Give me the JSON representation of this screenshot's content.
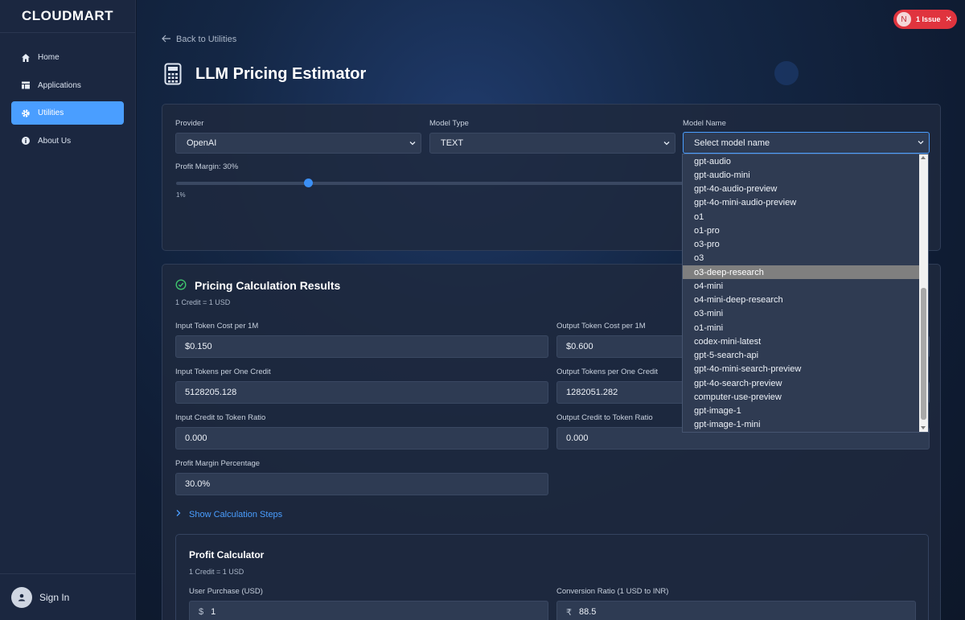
{
  "brand": "CLOUDMART",
  "nav": {
    "items": [
      {
        "label": "Home",
        "icon": "home-icon"
      },
      {
        "label": "Applications",
        "icon": "applications-icon"
      },
      {
        "label": "Utilities",
        "icon": "gear-icon",
        "active": true
      },
      {
        "label": "About Us",
        "icon": "info-icon"
      }
    ]
  },
  "sidebar_footer": {
    "sign_in": "Sign In"
  },
  "issue_badge": {
    "letter": "N",
    "label": "1 Issue"
  },
  "header": {
    "back_label": "Back to Utilities",
    "title": "LLM Pricing Estimator"
  },
  "config": {
    "provider_label": "Provider",
    "provider_value": "OpenAI",
    "model_type_label": "Model Type",
    "model_type_value": "TEXT",
    "model_name_label": "Model Name",
    "model_name_value": "Select model name",
    "profit_margin_label": "Profit Margin: 30%",
    "profit_margin_value": 30,
    "slider_min": "1%"
  },
  "model_options": [
    "gpt-audio",
    "gpt-audio-mini",
    "gpt-4o-audio-preview",
    "gpt-4o-mini-audio-preview",
    "o1",
    "o1-pro",
    "o3-pro",
    "o3",
    "o3-deep-research",
    "o4-mini",
    "o4-mini-deep-research",
    "o3-mini",
    "o1-mini",
    "codex-mini-latest",
    "gpt-5-search-api",
    "gpt-4o-mini-search-preview",
    "gpt-4o-search-preview",
    "computer-use-preview",
    "gpt-image-1",
    "gpt-image-1-mini"
  ],
  "highlighted_option": "o3-deep-research",
  "results": {
    "title": "Pricing Calculation Results",
    "credit_note": "1 Credit = 1 USD",
    "input_cost_label": "Input Token Cost per 1M",
    "input_cost_value": "$0.150",
    "output_cost_label": "Output Token Cost per 1M",
    "output_cost_value": "$0.600",
    "input_tokens_label": "Input Tokens per One Credit",
    "input_tokens_value": "5128205.128",
    "output_tokens_label": "Output Tokens per One Credit",
    "output_tokens_value": "1282051.282",
    "input_ratio_label": "Input Credit to Token Ratio",
    "input_ratio_value": "0.000",
    "output_ratio_label": "Output Credit to Token Ratio",
    "output_ratio_value": "0.000",
    "margin_pct_label": "Profit Margin Percentage",
    "margin_pct_value": "30.0%",
    "steps_link": "Show Calculation Steps"
  },
  "profit_calc": {
    "title": "Profit Calculator",
    "credit_note": "1 Credit = 1 USD",
    "purchase_label": "User Purchase (USD)",
    "purchase_prefix": "$",
    "purchase_value": "1",
    "conversion_label": "Conversion Ratio (1 USD to INR)",
    "conversion_prefix": "₹",
    "conversion_value": "88.5"
  },
  "colors": {
    "accent": "#4a9eff",
    "sidebar_bg": "#1b2740",
    "issue_red": "#e0343e"
  }
}
